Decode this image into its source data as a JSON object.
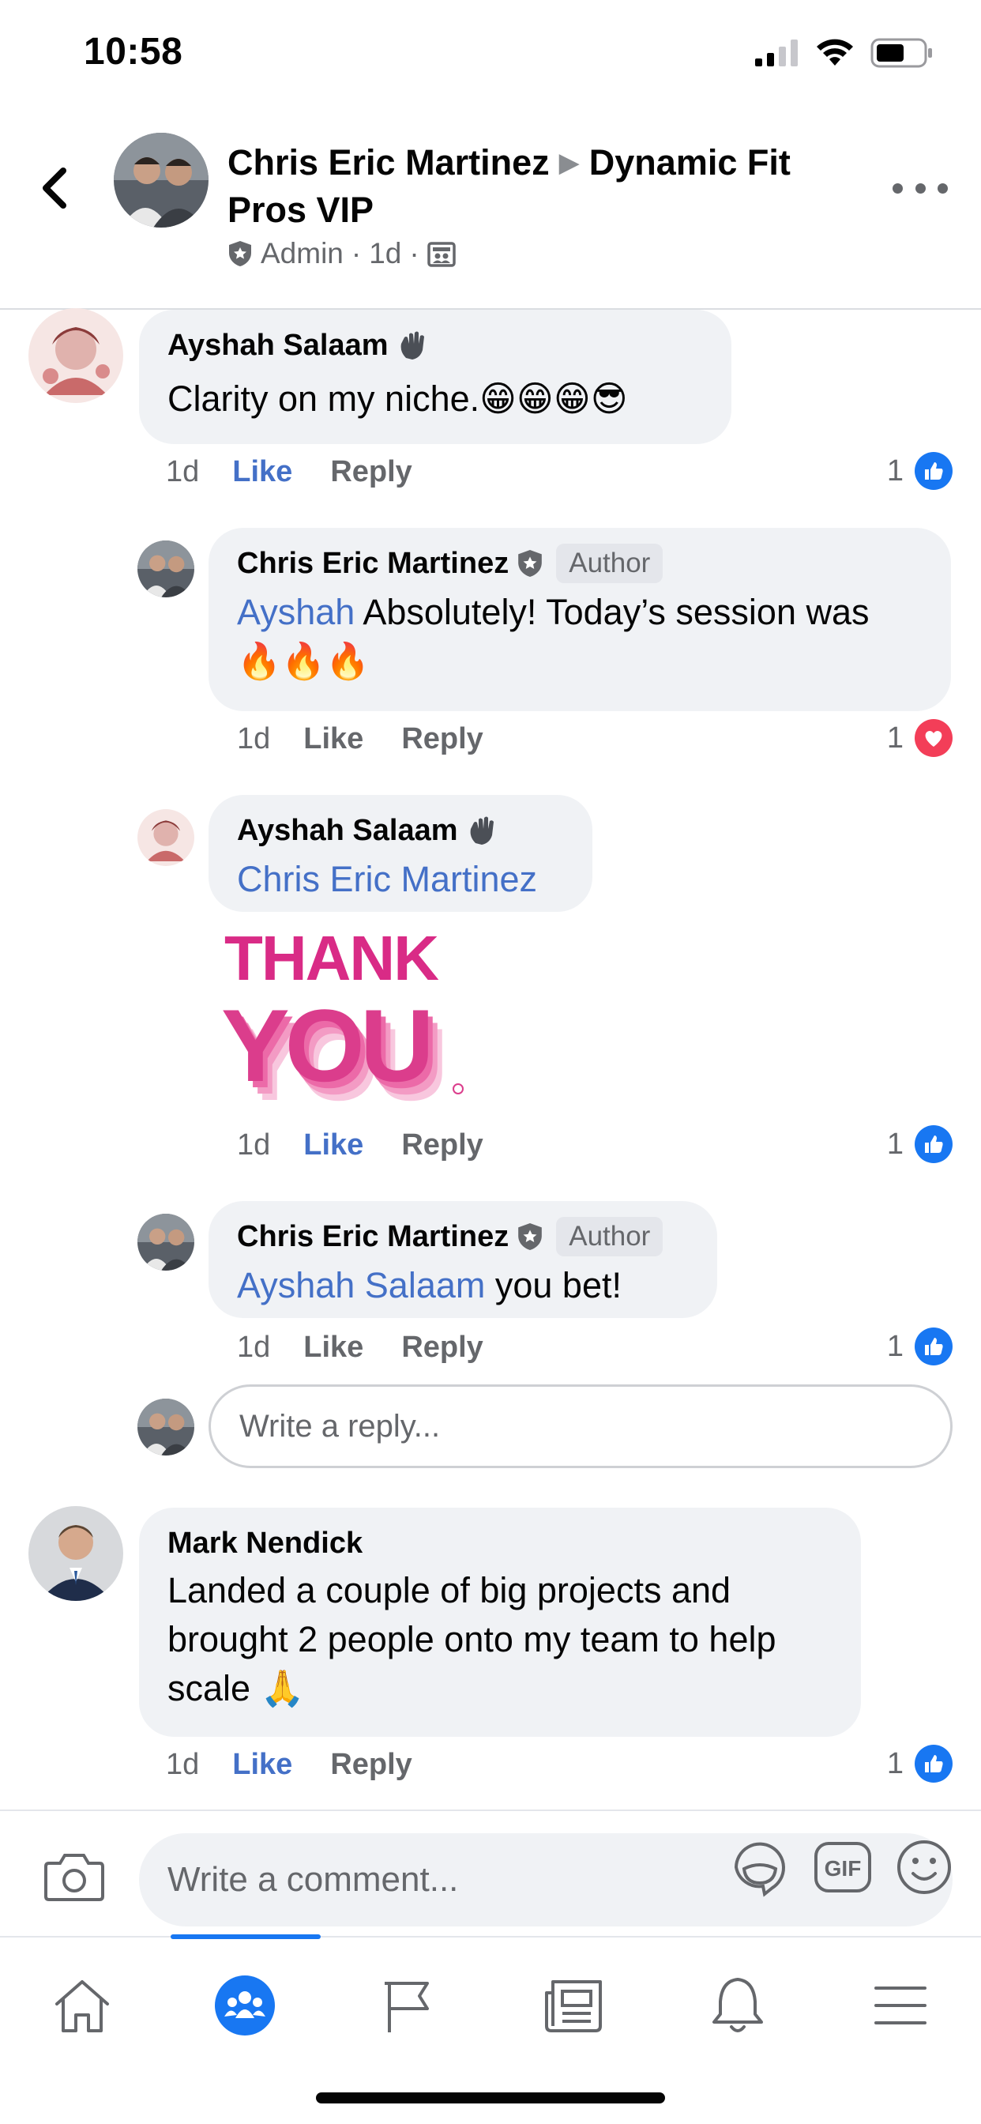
{
  "status_bar": {
    "time": "10:58",
    "icons": [
      "cellular-signal-icon",
      "wifi-icon",
      "battery-icon"
    ]
  },
  "header": {
    "author": "Chris Eric Martinez",
    "group": "Dynamic Fit Pros VIP",
    "role": "Admin",
    "age": "1d",
    "separator": "·"
  },
  "comments": [
    {
      "name": "Ayshah Salaam",
      "text": "Clarity on my niche.😁😁😁😎",
      "age": "1d",
      "like_label": "Like",
      "reply_label": "Reply",
      "reaction_count": "1",
      "liked": true
    },
    {
      "name": "Chris Eric Martinez",
      "badge": "Author",
      "mention": "Ayshah",
      "text": " Absolutely! Today’s session was 🔥🔥🔥",
      "age": "1d",
      "like_label": "Like",
      "reply_label": "Reply",
      "reaction_count": "1"
    },
    {
      "name": "Ayshah Salaam",
      "mention": "Chris Eric Martinez",
      "sticker_line1": "THANK",
      "sticker_line2": "YOU",
      "age": "1d",
      "like_label": "Like",
      "reply_label": "Reply",
      "reaction_count": "1",
      "liked": true
    },
    {
      "name": "Chris Eric Martinez",
      "badge": "Author",
      "mention": "Ayshah Salaam",
      "text": " you bet!",
      "age": "1d",
      "like_label": "Like",
      "reply_label": "Reply",
      "reaction_count": "1"
    },
    {
      "name": "Mark Nendick",
      "text": "Landed a couple of big projects and brought 2 people onto my team to help scale 🙏",
      "age": "1d",
      "like_label": "Like",
      "reply_label": "Reply",
      "reaction_count": "1",
      "liked": true
    }
  ],
  "reply_input": {
    "placeholder": "Write a reply..."
  },
  "composer": {
    "placeholder": "Write a comment..."
  },
  "tabs": [
    "home-icon",
    "groups-icon",
    "pages-icon",
    "news-icon",
    "notifications-icon",
    "menu-icon"
  ],
  "colors": {
    "accent": "#1877f2",
    "link": "#4470c7",
    "bubble": "#f0f2f5",
    "muted": "#65676b"
  }
}
